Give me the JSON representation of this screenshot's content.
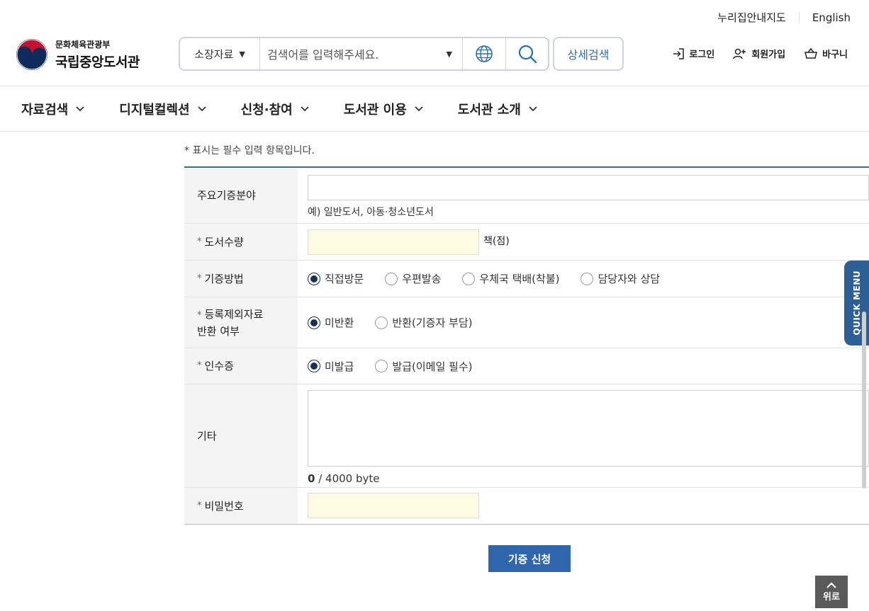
{
  "util": {
    "sitemap": "누리집안내지도",
    "english": "English"
  },
  "logo": {
    "ministry": "문화체육관광부",
    "library": "국립중앙도서관"
  },
  "search": {
    "scope": "소장자료",
    "placeholder": "검색어를 입력해주세요.",
    "advanced": "상세검색"
  },
  "user": {
    "login": "로그인",
    "join": "회원가입",
    "cart": "바구니"
  },
  "gnb": [
    {
      "label": "자료검색"
    },
    {
      "label": "디지털컬렉션"
    },
    {
      "label": "신청·참여"
    },
    {
      "label": "도서관 이용"
    },
    {
      "label": "도서관 소개"
    }
  ],
  "form": {
    "note": "* 표시는 필수 입력 항목입니다.",
    "star": "*",
    "fields": {
      "genre_label": "주요기증분야",
      "genre_hint": "예) 일반도서, 아동·청소년도서",
      "qty_label": "도서수량",
      "qty_unit": "책(점)",
      "method_label": "기증방법",
      "method_options": [
        "직접방문",
        "우편발송",
        "우체국 택배(착불)",
        "담당자와 상담"
      ],
      "return_label_1": "등록제외자료",
      "return_label_2": "반환 여부",
      "return_options": [
        "미반환",
        "반환(기증자 부담)"
      ],
      "receipt_label": "인수증",
      "receipt_options": [
        "미발급",
        "발급(이메일 필수)"
      ],
      "etc_label": "기타",
      "etc_count": "0",
      "etc_limit": " / 4000 byte",
      "pw_label": "비밀번호"
    },
    "submit": "기증 신청"
  },
  "quick_menu": "QUICK MENU",
  "to_top": "위로",
  "colors": {
    "brand_blue": "#2f66ae",
    "table_top": "#3f6d80",
    "required_field": "#fefbe3",
    "radio_selected": "#1a2f56"
  }
}
